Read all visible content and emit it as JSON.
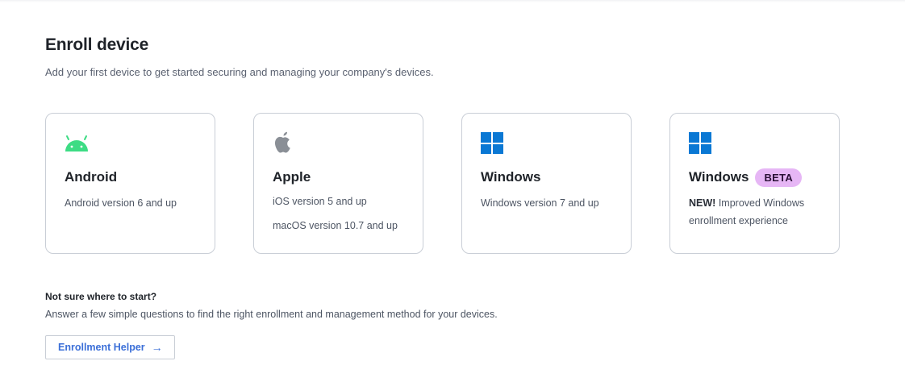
{
  "header": {
    "title": "Enroll device",
    "subtitle": "Add your first device to get started securing and managing your company's devices."
  },
  "cards": [
    {
      "name": "Android",
      "icon": "android-icon",
      "lines": [
        "Android version 6 and up"
      ]
    },
    {
      "name": "Apple",
      "icon": "apple-icon",
      "lines": [
        "iOS version 5 and up",
        "macOS version 10.7 and up"
      ]
    },
    {
      "name": "Windows",
      "icon": "windows-icon",
      "lines": [
        "Windows version 7 and up"
      ]
    },
    {
      "name": "Windows",
      "icon": "windows-icon",
      "badge": "BETA",
      "new_label": "NEW!",
      "description": "Improved Windows enrollment experience"
    }
  ],
  "helper": {
    "title": "Not sure where to start?",
    "text": "Answer a few simple questions to find the right enrollment and management method for your devices.",
    "button_label": "Enrollment Helper",
    "button_icon": "arrow-right-icon"
  },
  "colors": {
    "android_green": "#3ddc84",
    "apple_gray": "#8a8f96",
    "windows_blue": "#0a78d4",
    "beta_badge": "#e6b6f5",
    "link_blue": "#3b6fd8"
  }
}
